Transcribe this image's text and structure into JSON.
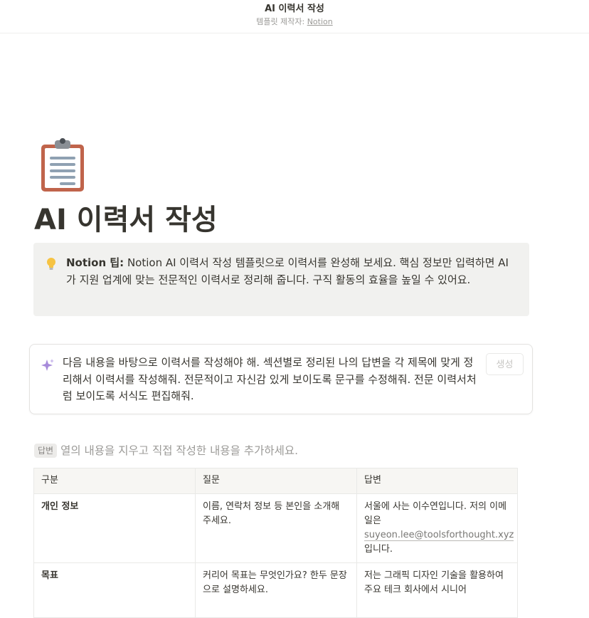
{
  "header": {
    "title": "AI 이력서 작성",
    "credit_prefix": "템플릿 제작자: ",
    "credit_link": "Notion"
  },
  "page": {
    "icon": "clipboard-icon",
    "title": "AI 이력서 작성"
  },
  "callout": {
    "icon": "lightbulb-icon",
    "bold": "Notion 팁:",
    "text": " Notion AI 이력서 작성 템플릿으로 이력서를 완성해 보세요. 핵심 정보만 입력하면 AI가 지원 업계에 맞는 전문적인 이력서로 정리해 줍니다. 구직 활동의 효율을 높일 수 있어요."
  },
  "ai_block": {
    "icon": "sparkle-icon",
    "prompt": "다음 내용을 바탕으로 이력서를 작성해야 해. 섹션별로 정리된 나의 답변을 각 제목에 맞게 정리해서 이력서를 작성해줘. 전문적이고 자신감 있게 보이도록 문구를 수정해줘. 전문 이력서처럼 보이도록 서식도 편집해줘.",
    "button_label": "생성"
  },
  "hint": {
    "tag": "답변",
    "text": "열의 내용을 지우고 직접 작성한 내용을 추가하세요."
  },
  "table": {
    "headers": [
      "구분",
      "질문",
      "답변"
    ],
    "rows": [
      {
        "category": "개인 정보",
        "question": "이름, 연락처 정보 등 본인을 소개해 주세요.",
        "answer_before": "서울에 사는 이수연입니다. 저의 이메일은 ",
        "answer_email": "suyeon.lee@toolsforthought.xyz",
        "answer_after": " 입니다."
      },
      {
        "category": "목표",
        "question": "커리어 목표는 무엇인가요? 한두 문장으로 설명하세요.",
        "answer": "저는 그래픽 디자인 기술을 활용하여 주요 테크 회사에서 시니어"
      }
    ]
  },
  "colors": {
    "text": "#37352f",
    "muted": "#9b9a97",
    "callout_bg": "#f1f1ef",
    "border": "#e9e9e7",
    "sparkle": "#a78bda"
  }
}
